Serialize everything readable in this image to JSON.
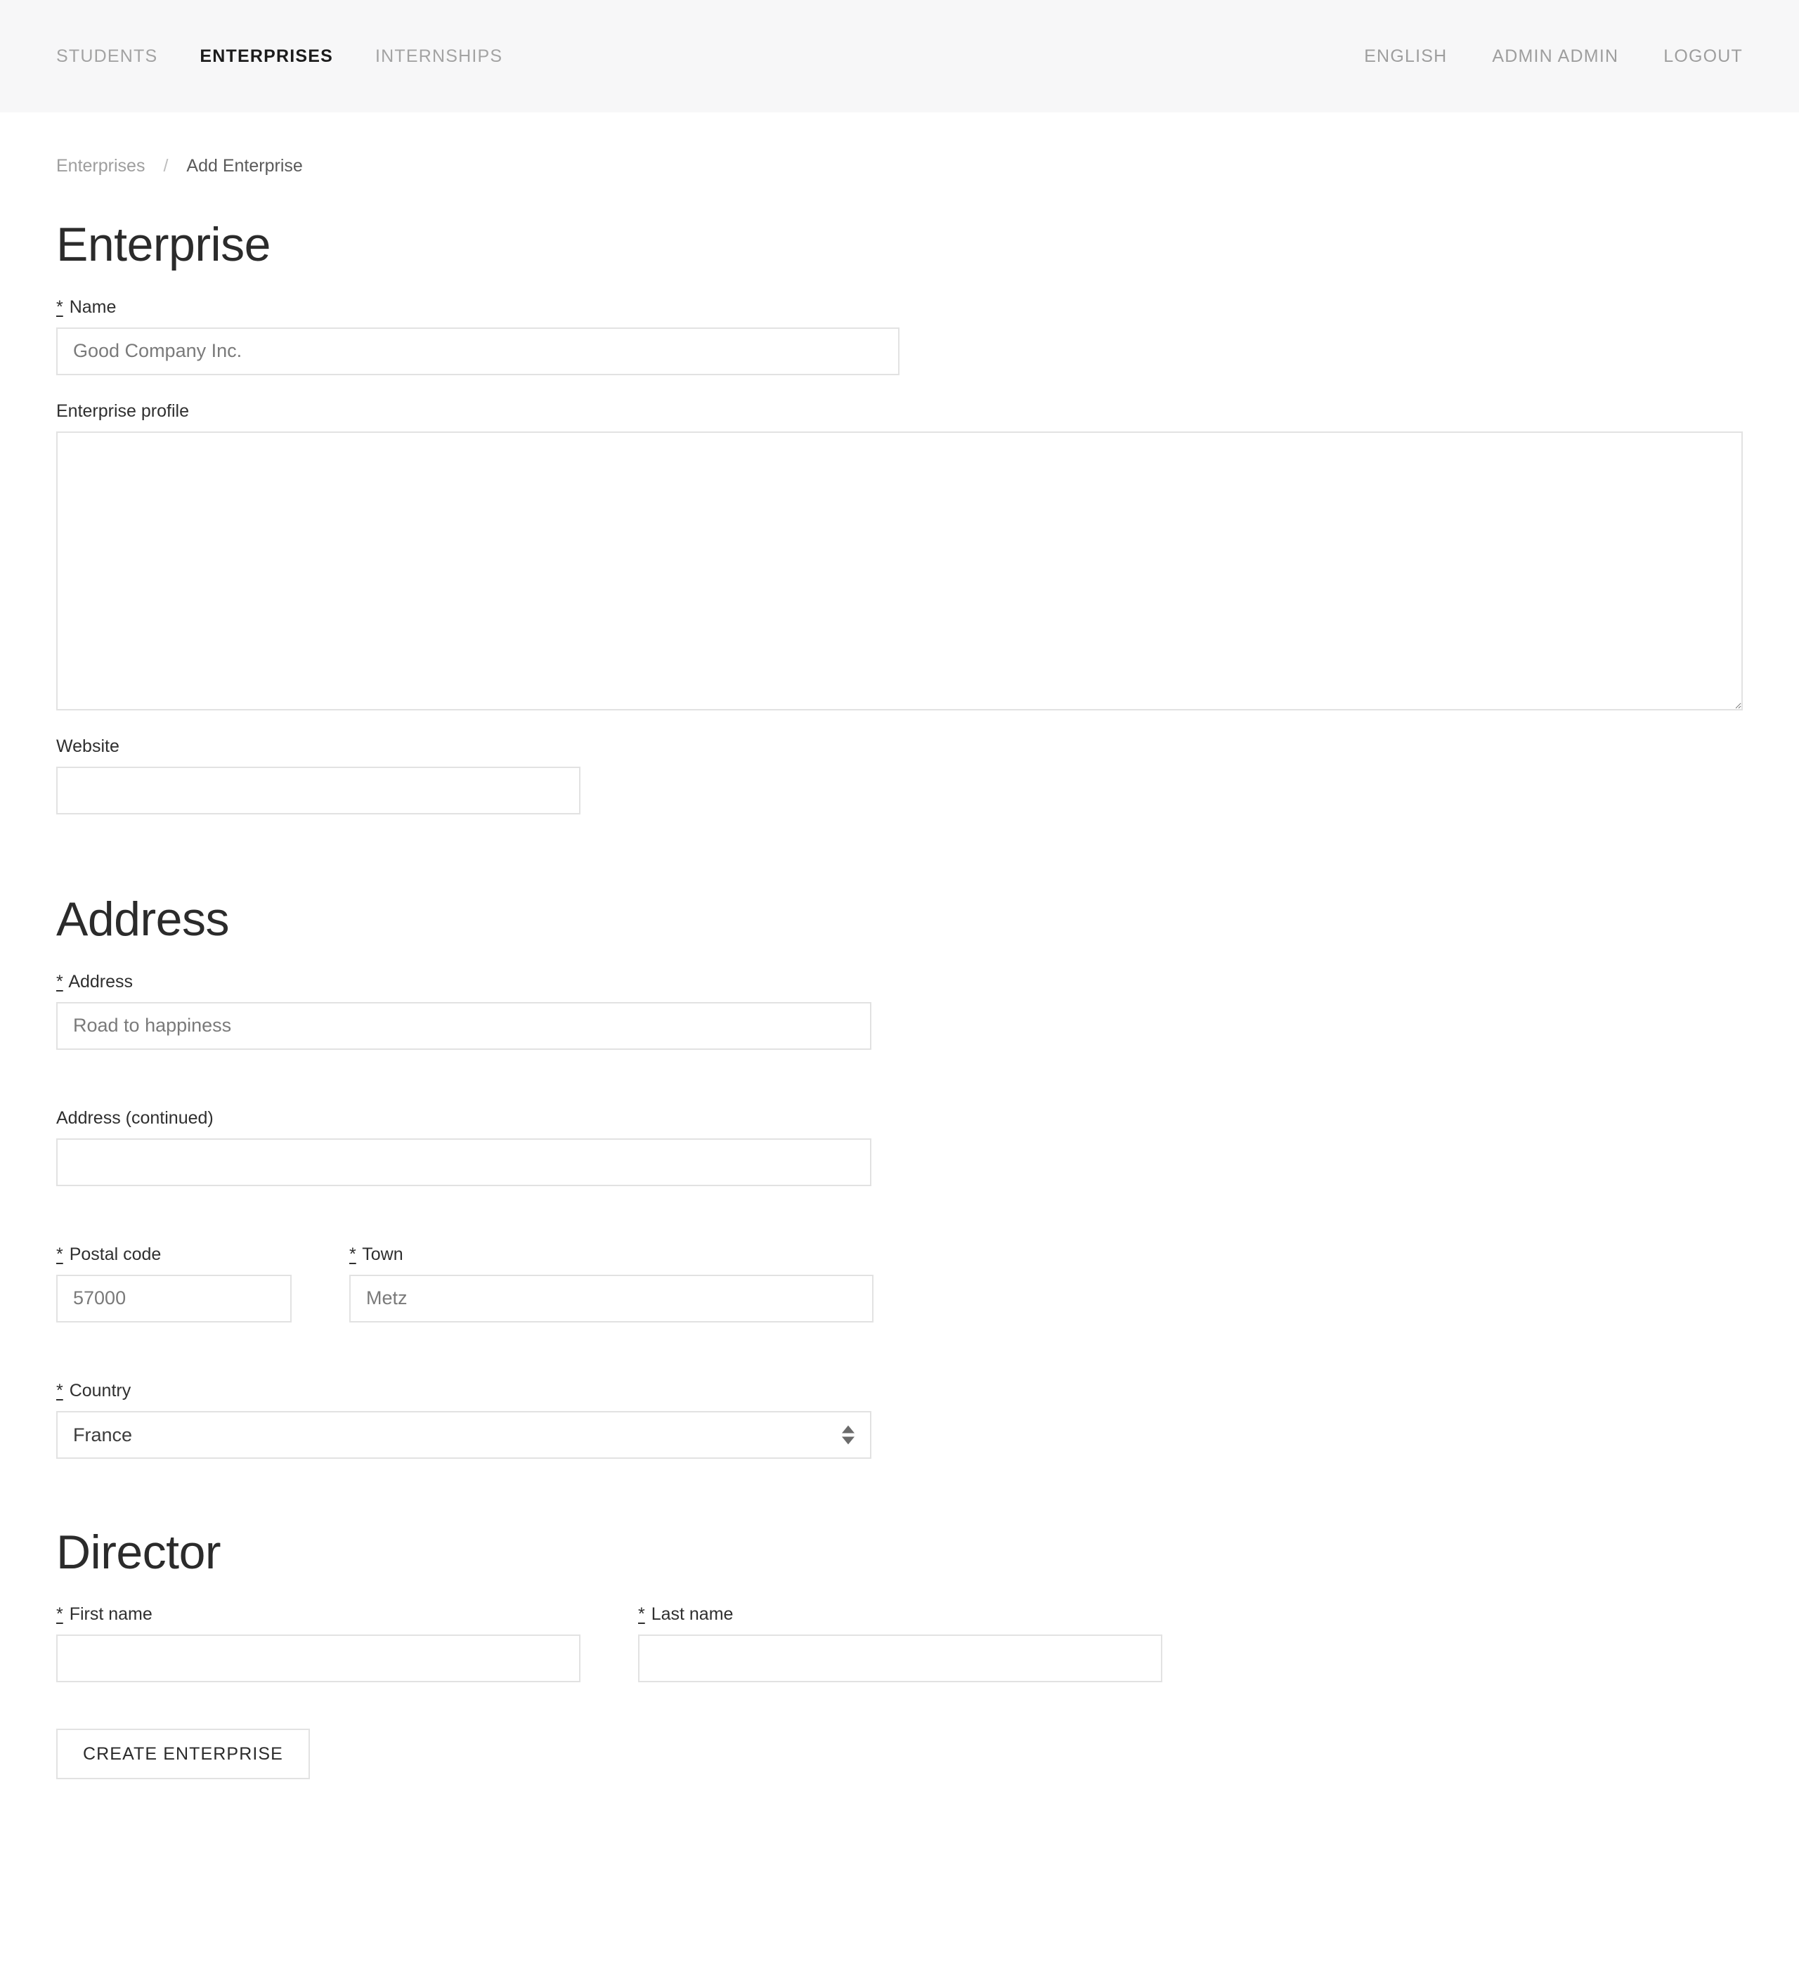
{
  "navbar": {
    "left_items": [
      {
        "label": "STUDENTS",
        "active": false
      },
      {
        "label": "ENTERPRISES",
        "active": true
      },
      {
        "label": "INTERNSHIPS",
        "active": false
      }
    ],
    "right_items": [
      {
        "label": "ENGLISH"
      },
      {
        "label": "ADMIN ADMIN"
      },
      {
        "label": "LOGOUT"
      }
    ]
  },
  "breadcrumb": {
    "parent": "Enterprises",
    "separator": "/",
    "current": "Add Enterprise"
  },
  "enterprise_section": {
    "title": "Enterprise",
    "name": {
      "required_marker": "*",
      "label": "Name",
      "value": "",
      "placeholder": "Good Company Inc."
    },
    "profile": {
      "label": "Enterprise profile",
      "value": "",
      "placeholder": ""
    },
    "website": {
      "label": "Website",
      "value": "",
      "placeholder": ""
    }
  },
  "address_section": {
    "title": "Address",
    "address": {
      "required_marker": "*",
      "label": "Address",
      "value": "",
      "placeholder": "Road to happiness"
    },
    "address_continued": {
      "label": "Address (continued)",
      "value": "",
      "placeholder": ""
    },
    "postal_code": {
      "required_marker": "*",
      "label": "Postal code",
      "value": "",
      "placeholder": "57000"
    },
    "town": {
      "required_marker": "*",
      "label": "Town",
      "value": "",
      "placeholder": "Metz"
    },
    "country": {
      "required_marker": "*",
      "label": "Country",
      "selected": "France",
      "options": [
        "France"
      ]
    }
  },
  "director_section": {
    "title": "Director",
    "first_name": {
      "required_marker": "*",
      "label": "First name",
      "value": "",
      "placeholder": ""
    },
    "last_name": {
      "required_marker": "*",
      "label": "Last name",
      "value": "",
      "placeholder": ""
    }
  },
  "submit": {
    "label": "CREATE ENTERPRISE"
  },
  "colors": {
    "header_background": "#f7f7f8",
    "page_background": "#ffffff",
    "text_primary": "#212121",
    "text_muted": "#9e9e9e",
    "input_border": "#e2e2e2",
    "placeholder": "#7a7a7a"
  }
}
